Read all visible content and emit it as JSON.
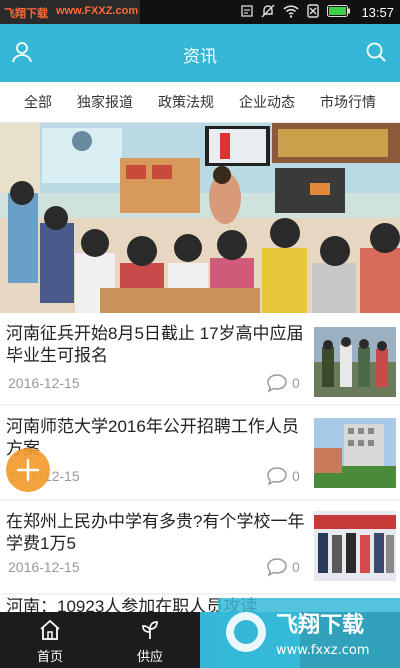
{
  "watermark": {
    "logo": "飞翔下载",
    "url": "www.FXXZ.com",
    "bottom_brand": "飞翔下载",
    "bottom_url": "www.fxxz.com"
  },
  "status": {
    "time": "13:57"
  },
  "header": {
    "title": "资讯",
    "left_icon": "user-icon",
    "right_icon": "search-icon"
  },
  "tabs": [
    "全部",
    "独家报道",
    "政策法规",
    "企业动态",
    "市场行情"
  ],
  "news": [
    {
      "title": "河南征兵开始8月5日截止 17岁高中应届毕业生可报名",
      "date": "2016-12-15",
      "comments": "0"
    },
    {
      "title": "河南师范大学2016年公开招聘工作人员方案",
      "date": "2016-12-15",
      "comments": "0"
    },
    {
      "title": "在郑州上民办中学有多贵?有个学校一年学费1万5",
      "date": "2016-12-15",
      "comments": "0"
    },
    {
      "title": "河南：10923人参加在职人员攻读",
      "date": "",
      "comments": ""
    }
  ],
  "bottom_nav": [
    {
      "label": "首页",
      "icon": "home-icon"
    },
    {
      "label": "供应",
      "icon": "leaf-icon"
    },
    {
      "label": "",
      "icon": ""
    },
    {
      "label": "",
      "icon": ""
    }
  ],
  "colors": {
    "accent": "#35b8d8",
    "fab": "#f39a2b",
    "status_bar": "#111111",
    "nav_bar": "#1c1c1c"
  }
}
